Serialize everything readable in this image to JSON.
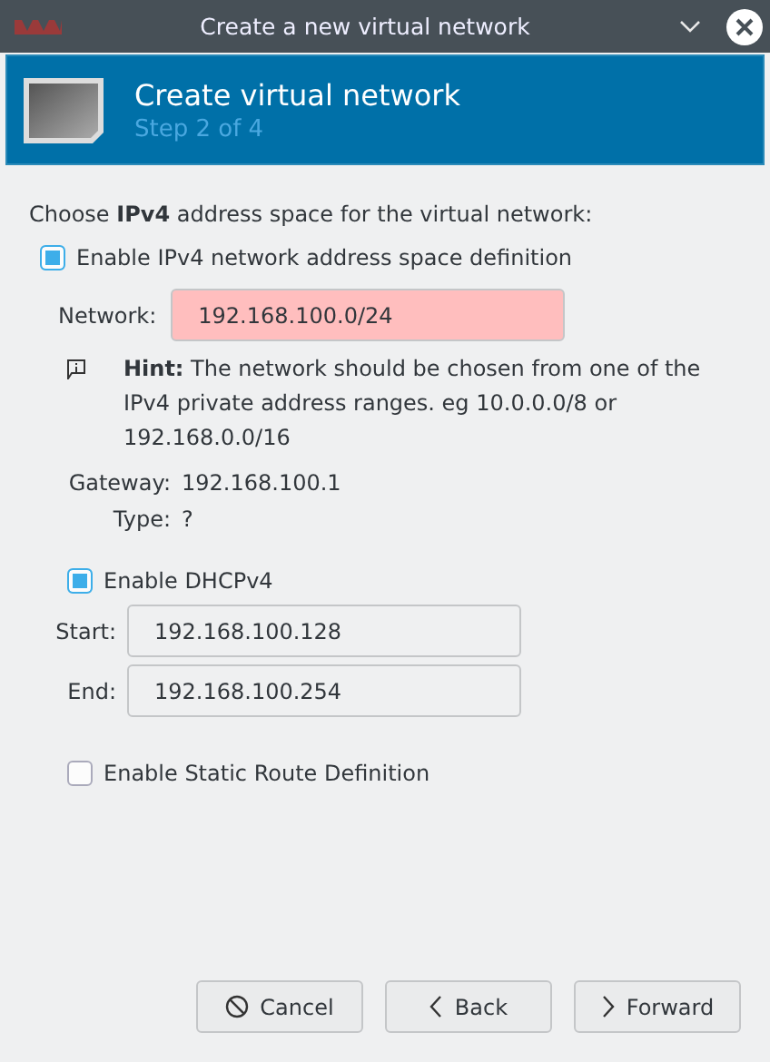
{
  "window": {
    "title": "Create a new virtual network"
  },
  "banner": {
    "title": "Create virtual network",
    "subtitle": "Step 2 of 4"
  },
  "intro": "Choose **IPv4** address space for the virtual network:",
  "ipv4_checkbox": {
    "label": "Enable IPv4 network address space definition",
    "checked": true
  },
  "network": {
    "label": "Network:",
    "value": "192.168.100.0/24",
    "invalid": true
  },
  "hint": "**Hint:** The network should be chosen from one of the IPv4 private address ranges. eg 10.0.0.0/8 or 192.168.0.0/16",
  "info": [
    {
      "label": "Gateway:",
      "value": "192.168.100.1"
    },
    {
      "label": "Type:",
      "value": "?"
    }
  ],
  "dhcp_checkbox": {
    "label": "Enable DHCPv4",
    "checked": true
  },
  "dhcp_fields": [
    {
      "label": "Start:",
      "value": "192.168.100.128",
      "invalid": false
    },
    {
      "label": "End:",
      "value": "192.168.100.254",
      "invalid": false
    }
  ],
  "static_route_checkbox": {
    "label": "Enable Static Route Definition",
    "checked": false
  },
  "buttons": [
    {
      "label": "Cancel",
      "kind": "cancel"
    },
    {
      "label": "Back",
      "kind": "back"
    },
    {
      "label": "Forward",
      "kind": "forward"
    }
  ]
}
